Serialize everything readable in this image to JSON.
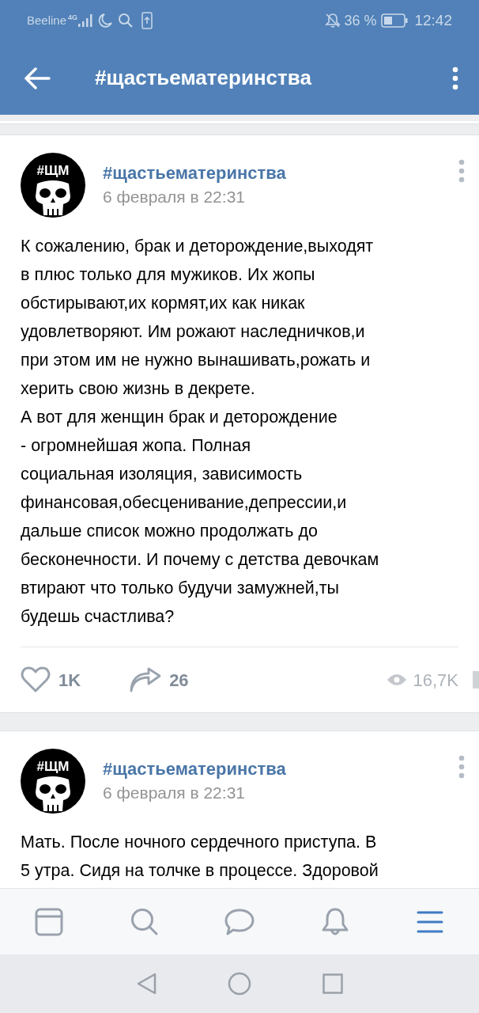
{
  "status_bar": {
    "carrier": "Beeline",
    "network": "4G",
    "battery": "36 %",
    "time": "12:42"
  },
  "header": {
    "title": "#щастьематеринства"
  },
  "posts": [
    {
      "avatar_label": "#ЩМ",
      "author": "#щастьематеринства",
      "date": "6 февраля в 22:31",
      "text": "К сожалению, брак и деторождение,выходят\nв плюс только для мужиков. Их жопы\nобстирывают,их кормят,их как никак\nудовлетворяют. Им рожают наследничков,и\nпри этом им не нужно вынашивать,рожать и\nхерить свою жизнь в декрете.\nА вот для женщин брак и деторождение\n- огромнейшая жопа. Полная\nсоциальная изоляция, зависимость\nфинансовая,обесценивание,депрессии,и\nдальше список можно продолжать до\nбесконечности. И почему с детства девочкам\nвтирают что только будучи замужней,ты\nбудешь счастлива?",
      "likes": "1K",
      "shares": "26",
      "views": "16,7K"
    },
    {
      "avatar_label": "#ЩМ",
      "author": "#щастьематеринства",
      "date": "6 февраля в 22:31",
      "text": "Мать. После ночного сердечного приступа. В\n5 утра. Сидя на толчке в процессе. Здоровой"
    }
  ],
  "tab_bar": [
    {
      "kind": "news",
      "selected": false
    },
    {
      "kind": "search",
      "selected": false
    },
    {
      "kind": "messages",
      "selected": false
    },
    {
      "kind": "notifications",
      "selected": false
    },
    {
      "kind": "menu",
      "selected": true
    }
  ]
}
